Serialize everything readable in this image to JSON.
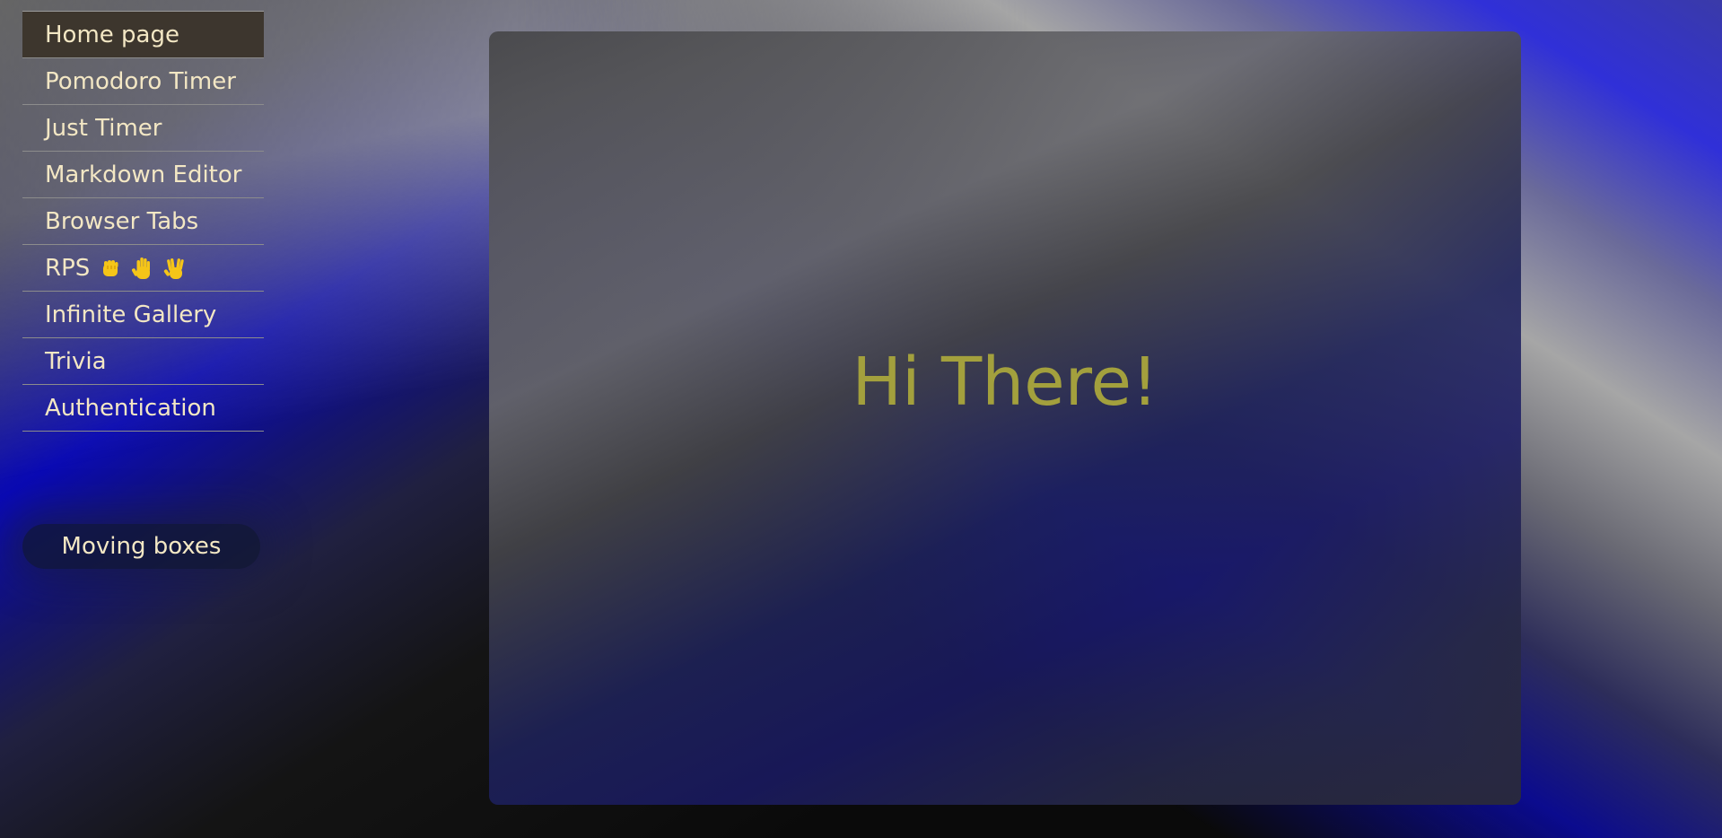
{
  "nav": {
    "items": [
      {
        "label": "Home page",
        "active": true
      },
      {
        "label": "Pomodoro Timer"
      },
      {
        "label": "Just Timer"
      },
      {
        "label": "Markdown Editor"
      },
      {
        "label": "Browser Tabs"
      },
      {
        "label": "RPS",
        "icons": [
          "raised-fist-icon",
          "raised-hand-icon",
          "vulcan-salute-icon"
        ]
      },
      {
        "label": "Infinite Gallery"
      },
      {
        "label": "Trivia"
      },
      {
        "label": "Authentication"
      }
    ]
  },
  "moving_boxes": {
    "label": "Moving boxes"
  },
  "main": {
    "greeting": "Hi There!"
  },
  "colors": {
    "nav_text": "#f3e7c4",
    "greeting": "#a3a03d",
    "active_bg": "#3a3228"
  }
}
